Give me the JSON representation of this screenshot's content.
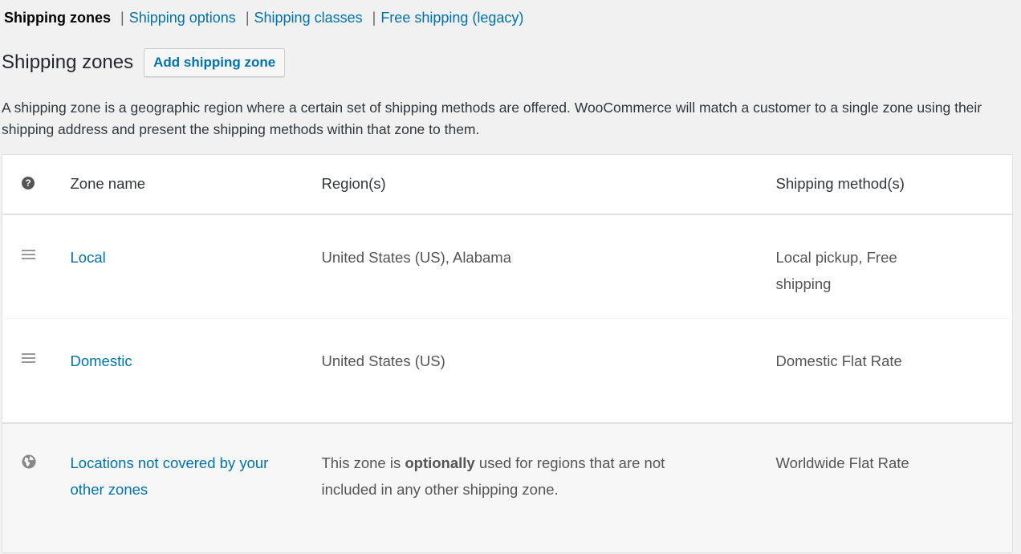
{
  "subnav": {
    "current": "Shipping zones",
    "links": [
      "Shipping options",
      "Shipping classes",
      "Free shipping (legacy)"
    ],
    "separator": "|"
  },
  "header": {
    "title": "Shipping zones",
    "add_button_label": "Add shipping zone"
  },
  "description": "A shipping zone is a geographic region where a certain set of shipping methods are offered. WooCommerce will match a customer to a single zone using their shipping address and present the shipping methods within that zone to them.",
  "table": {
    "help_icon_glyph": "?",
    "columns": [
      "Zone name",
      "Region(s)",
      "Shipping method(s)"
    ],
    "rows": [
      {
        "name": "Local",
        "regions": "United States (US), Alabama",
        "methods": "Local pickup, Free shipping"
      },
      {
        "name": "Domestic",
        "regions": "United States (US)",
        "methods": "Domestic Flat Rate"
      }
    ],
    "rest_of_world": {
      "name": "Locations not covered by your other zones",
      "regions_pre": "This zone is ",
      "regions_bold": "optionally",
      "regions_post": " used for regions that are not included in any other shipping zone.",
      "methods": "Worldwide Flat Rate"
    }
  },
  "colors": {
    "link": "#0073aa",
    "background": "#f1f1f1",
    "text": "#32373c"
  }
}
